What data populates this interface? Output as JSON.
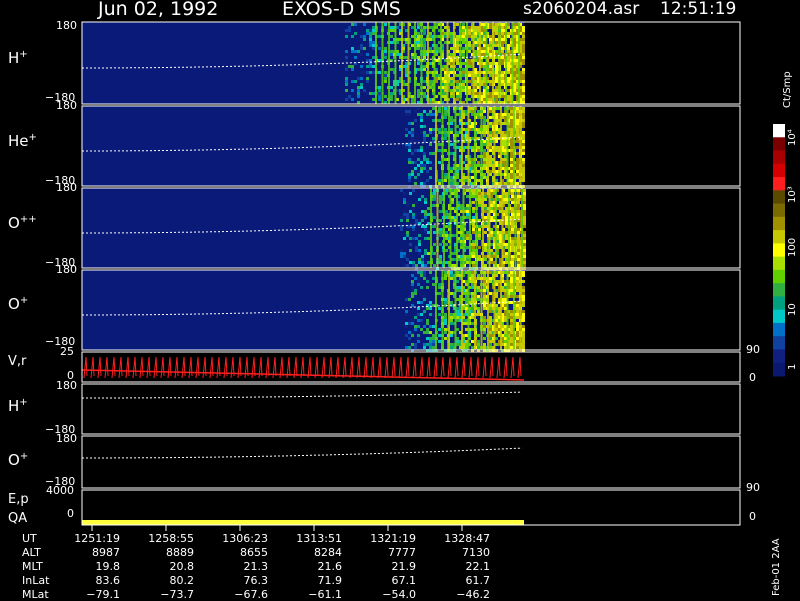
{
  "header": {
    "date": "Jun 02, 1992",
    "instrument": "EXOS-D SMS",
    "file": "s2060204.asr",
    "time": "12:51:19"
  },
  "panels": [
    {
      "label": "H",
      "sup": "+",
      "top_tick": "180",
      "bottom_tick": "−180"
    },
    {
      "label": "He",
      "sup": "+",
      "top_tick": "180",
      "bottom_tick": "−180"
    },
    {
      "label": "O",
      "sup": "++",
      "top_tick": "180",
      "bottom_tick": "−180"
    },
    {
      "label": "O",
      "sup": "+",
      "top_tick": "180",
      "bottom_tick": "−180"
    },
    {
      "label": "V,r",
      "sup": "",
      "top_tick": "25",
      "bottom_tick": "0",
      "right_top": "90",
      "right_bottom": "0"
    },
    {
      "label": "H",
      "sup": "+",
      "top_tick": "180",
      "bottom_tick": "−180"
    },
    {
      "label": "O",
      "sup": "+",
      "top_tick": "180",
      "bottom_tick": "−180"
    },
    {
      "label": "E,p",
      "sup": "",
      "top_tick": "4000",
      "bottom_tick": "0",
      "right_top": "90",
      "right_bottom": "0",
      "label2": "QA"
    }
  ],
  "colorbar": {
    "unit": "Ct/Smp",
    "ticks": [
      "10⁴",
      "10³",
      "100",
      "10",
      "1"
    ],
    "colors": [
      "#ffffff",
      "#7a0000",
      "#a80000",
      "#d40000",
      "#ff1e1e",
      "#5a4a00",
      "#7a6a00",
      "#a09000",
      "#c8c800",
      "#ffff00",
      "#a8e000",
      "#60d000",
      "#30b040",
      "#00a080",
      "#00c8c8",
      "#0070c8",
      "#1040a0",
      "#102080",
      "#0a1870"
    ]
  },
  "footer_note": "Feb-01 2AA",
  "table": {
    "row_labels": [
      "UT",
      "ALT",
      "MLT",
      "InLat",
      "MLat"
    ],
    "columns": [
      [
        "1251:19",
        "8987",
        "19.8",
        "83.6",
        "−79.1"
      ],
      [
        "1258:55",
        "8889",
        "20.8",
        "80.2",
        "−73.7"
      ],
      [
        "1306:23",
        "8655",
        "21.3",
        "76.3",
        "−67.6"
      ],
      [
        "1313:51",
        "8284",
        "21.6",
        "71.9",
        "−61.1"
      ],
      [
        "1321:19",
        "7777",
        "21.9",
        "67.1",
        "−54.0"
      ],
      [
        "1328:47",
        "7130",
        "22.1",
        "61.7",
        "−46.2"
      ]
    ]
  },
  "chart_data": {
    "type": "heatmap",
    "title": "Jun 02, 1992 EXOS-D SMS",
    "x_label": "UT",
    "x_ticks": [
      "1251:19",
      "1258:55",
      "1306:23",
      "1313:51",
      "1321:19",
      "1328:47"
    ],
    "y_range": [
      -180,
      180
    ],
    "data_end_ut": "1330:40",
    "series": [
      {
        "name": "H+",
        "onset_ut": "1316:00"
      },
      {
        "name": "He+",
        "onset_ut": "1320:00"
      },
      {
        "name": "O++",
        "onset_ut": "1321:00"
      },
      {
        "name": "O+",
        "onset_ut": "1321:00"
      }
    ],
    "colorscale": {
      "unit": "Ct/Smp",
      "min": 1,
      "max": 10000,
      "scale": "log"
    }
  }
}
